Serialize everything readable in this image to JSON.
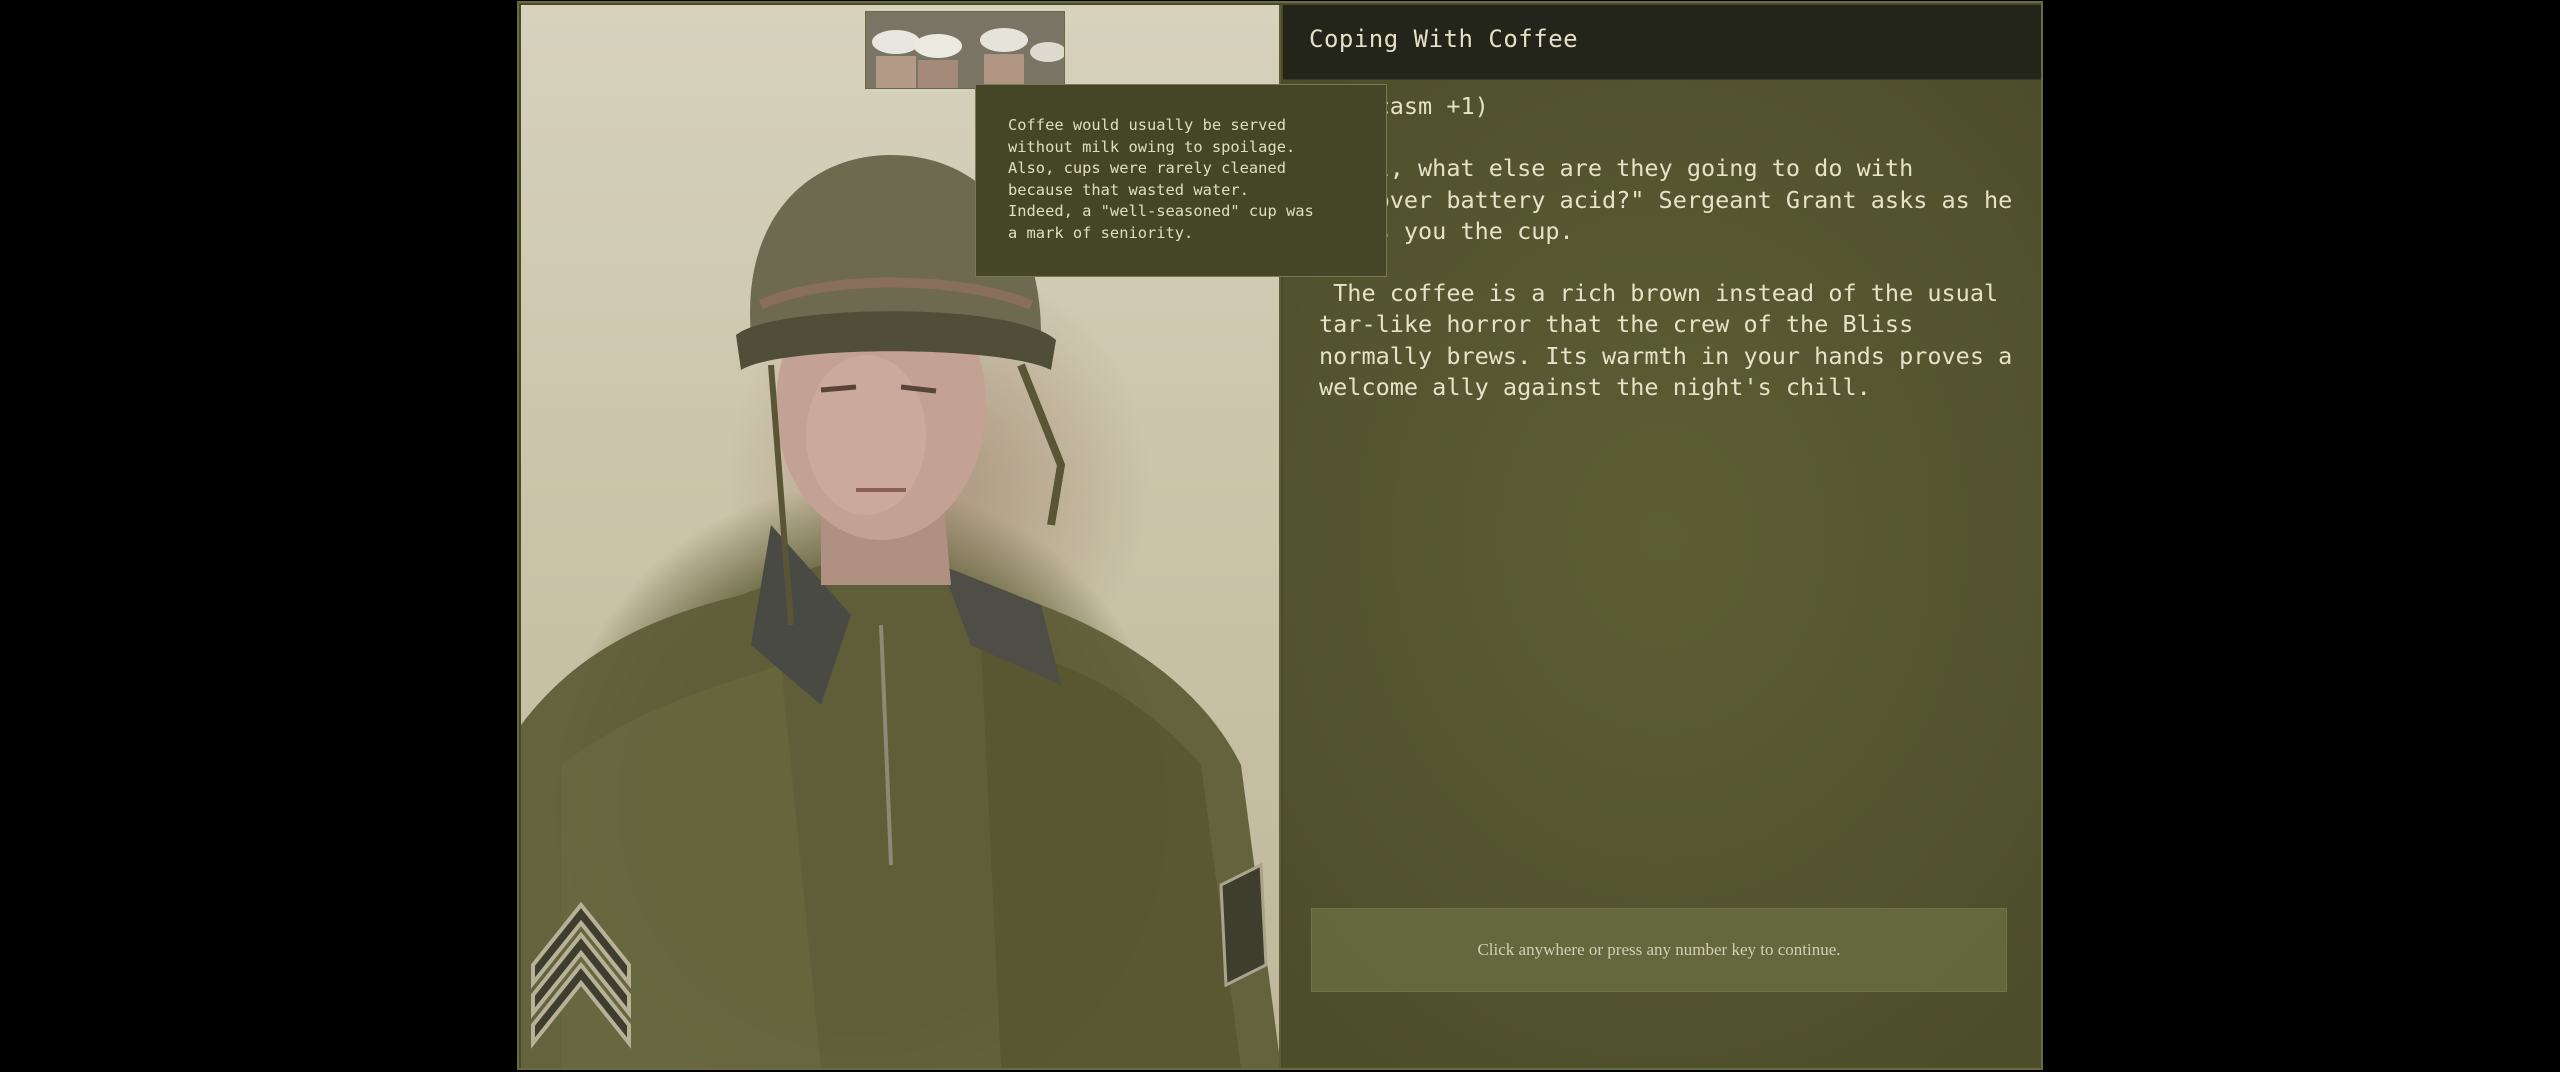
{
  "event": {
    "title": "Coping With Coffee",
    "story_paragraphs": [
      "(Sarcasm +1)",
      "\"Well, what else are they going to do with leftover battery acid?\" Sergeant Grant asks as he hands you the cup.",
      " The coffee is a rich brown instead of the usual tar-like horror that the crew of the Bliss normally brews. Its warmth in your hands proves a welcome ally against the night's chill."
    ],
    "continue_prompt": "Click anywhere or press any number key to continue."
  },
  "tooltip": {
    "text": "Coffee would usually be served\nwithout milk owing to spoilage.\nAlso, cups were rarely cleaned\nbecause that wasted water.\nIndeed, a \"well-seasoned\" cup was\na mark of seniority."
  },
  "icons": {
    "journal": "book-icon"
  },
  "colors": {
    "background": "#000000",
    "panel_olive": "#585931",
    "title_bar": "#23251a",
    "text": "#e6e2c8",
    "tooltip_bg": "#454627"
  }
}
